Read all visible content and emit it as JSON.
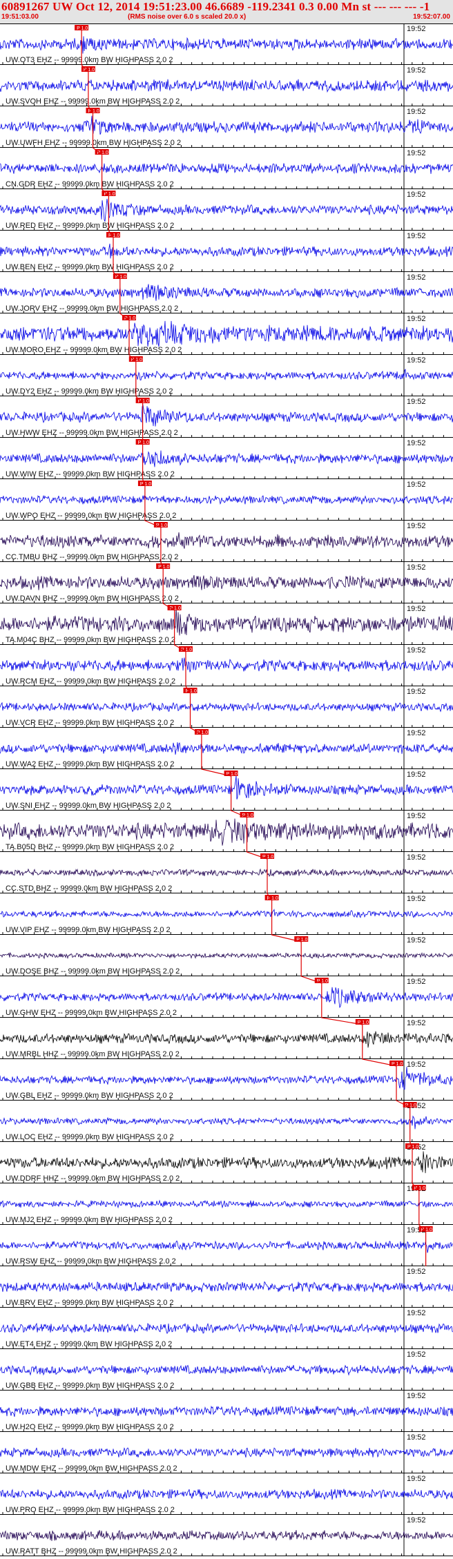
{
  "header": {
    "title": "60891267 UW Oct 12, 2014 19:51:23.00   46.6689 -119.2341  0.3 0.00 Mn st --- --- ---  -1",
    "start_time": "19:51:03.00",
    "note": "(RMS noise over 6.0 s scaled 20.0 x)",
    "end_time": "19:52:07.00"
  },
  "minute_label": "19:52",
  "pick_label": "P 1.0",
  "colors": {
    "blue": "#0000e6",
    "dark": "#1e0050",
    "black": "#000000",
    "pick": "#e00000",
    "grid": "#000000"
  },
  "traces": [
    {
      "label": "UW.OT3 EHZ -- 99999.0km BW  HIGHPASS  2.0  2",
      "color": "blue",
      "pick": 0.18,
      "amp": 0.35,
      "burst": [
        0.18,
        0.26,
        0.85
      ],
      "burst2": [
        0.8,
        0.92,
        0.45
      ]
    },
    {
      "label": "UW.SVOH EHZ -- 99999.0km BW  HIGHPASS  2.0  2",
      "color": "blue",
      "pick": 0.195,
      "amp": 0.35,
      "burst": [
        0.195,
        0.24,
        0.5
      ]
    },
    {
      "label": "UW.UWFH EHZ -- 99999.0km BW  HIGHPASS  2.0  2",
      "color": "blue",
      "pick": 0.205,
      "amp": 0.35,
      "burst": [
        0.2,
        0.26,
        1.0
      ],
      "burst2": [
        0.9,
        1.0,
        0.7
      ]
    },
    {
      "label": "CN.GDR EHZ -- 99999.0km BW  HIGHPASS  2.0  2",
      "color": "blue",
      "pick": 0.225,
      "amp": 0.3,
      "burst": [
        0.22,
        0.28,
        0.5
      ]
    },
    {
      "label": "UW.RED EHZ -- 99999.0km BW  HIGHPASS  2.0  2",
      "color": "blue",
      "pick": 0.24,
      "amp": 0.3,
      "burst": [
        0.22,
        0.32,
        1.0
      ]
    },
    {
      "label": "UW.BEN EHZ -- 99999.0km BW  HIGHPASS  2.0  2",
      "color": "blue",
      "pick": 0.25,
      "amp": 0.3,
      "burst": [
        0.24,
        0.28,
        0.6
      ]
    },
    {
      "label": "UW.JORV EHZ -- 99999.0km BW  HIGHPASS  2.0  2",
      "color": "blue",
      "pick": 0.265,
      "amp": 0.3,
      "burst": [
        0.3,
        0.6,
        0.6
      ]
    },
    {
      "label": "UW.MORO EHZ -- 99999.0km BW  HIGHPASS  2.0  2",
      "color": "blue",
      "pick": 0.285,
      "amp": 0.5,
      "burst": [
        0.28,
        0.85,
        1.0
      ]
    },
    {
      "label": "UW.DY2 EHZ -- 99999.0km BW  HIGHPASS  2.0  2",
      "color": "blue",
      "pick": 0.3,
      "amp": 0.25,
      "burst": [
        0.3,
        0.34,
        0.6
      ],
      "burst2": [
        0.88,
        0.95,
        0.6
      ]
    },
    {
      "label": "UW.HWW EHZ -- 99999.0km BW  HIGHPASS  2.0  2",
      "color": "blue",
      "pick": 0.315,
      "amp": 0.3,
      "burst": [
        0.31,
        0.42,
        1.0
      ]
    },
    {
      "label": "UW.WIW EHZ -- 99999.0km BW  HIGHPASS  2.0  2",
      "color": "blue",
      "pick": 0.315,
      "amp": 0.3,
      "burst": [
        0.31,
        0.42,
        1.0
      ]
    },
    {
      "label": "UW.WPO EHZ -- 99999.0km BW  HIGHPASS  2.0  2",
      "color": "blue",
      "pick": 0.32,
      "amp": 0.25,
      "burst": [
        0.32,
        0.36,
        0.3
      ]
    },
    {
      "label": "CC.TMBU BHZ -- 99999.0km BW  HIGHPASS  2.0  2",
      "color": "dark",
      "pick": 0.355,
      "amp": 0.4,
      "burst": [
        0.36,
        0.85,
        0.6
      ]
    },
    {
      "label": "UW.DAVN BHZ -- 99999.0km BW  HIGHPASS  2.0  2",
      "color": "dark",
      "pick": 0.36,
      "amp": 0.4,
      "burst": [
        0.4,
        0.85,
        0.5
      ],
      "burst2": [
        0.88,
        1.0,
        0.4
      ]
    },
    {
      "label": "TA.M04C BHZ -- 99999.0km BW  HIGHPASS  2.0  2",
      "color": "dark",
      "pick": 0.385,
      "amp": 0.5,
      "burst": [
        0.38,
        0.55,
        1.0
      ]
    },
    {
      "label": "UW.RCM EHZ -- 99999.0km BW  HIGHPASS  2.0  2",
      "color": "blue",
      "pick": 0.41,
      "amp": 0.35,
      "burst": [
        0.4,
        0.45,
        1.0
      ]
    },
    {
      "label": "UW.VCR EHZ -- 99999.0km BW  HIGHPASS  2.0  2",
      "color": "blue",
      "pick": 0.42,
      "amp": 0.25,
      "burst": [
        0.42,
        0.46,
        0.4
      ]
    },
    {
      "label": "UW.WA2 EHZ -- 99999.0km BW  HIGHPASS  2.0  2",
      "color": "blue",
      "pick": 0.445,
      "amp": 0.3,
      "burst": [
        0.38,
        0.48,
        0.7
      ]
    },
    {
      "label": "UW.SNI EHZ -- 99999.0km BW  HIGHPASS  2.0  2",
      "color": "blue",
      "pick": 0.51,
      "amp": 0.3,
      "burst": [
        0.51,
        0.65,
        1.0
      ],
      "burst2": [
        0.2,
        0.25,
        0.6
      ]
    },
    {
      "label": "TA.B05D BHZ -- 99999.0km BW  HIGHPASS  2.0  2",
      "color": "dark",
      "pick": 0.545,
      "amp": 0.5,
      "burst": [
        0.45,
        1.0,
        1.0
      ]
    },
    {
      "label": "CC.STD BHZ -- 99999.0km BW  HIGHPASS  2.0  2",
      "color": "dark",
      "pick": 0.59,
      "amp": 0.2,
      "burst": [
        0.59,
        0.62,
        0.3
      ]
    },
    {
      "label": "UW.VIP EHZ -- 99999.0km BW  HIGHPASS  2.0  2",
      "color": "blue",
      "pick": 0.6,
      "amp": 0.2,
      "burst": [
        0.6,
        0.64,
        0.4
      ]
    },
    {
      "label": "UW.DOSE BHZ -- 99999.0km BW  HIGHPASS  2.0  2",
      "color": "dark",
      "pick": 0.665,
      "amp": 0.15,
      "burst": [
        0.68,
        0.72,
        0.3
      ]
    },
    {
      "label": "UW.GHW EHZ -- 99999.0km BW  HIGHPASS  2.0  2",
      "color": "blue",
      "pick": 0.71,
      "amp": 0.25,
      "burst": [
        0.72,
        0.9,
        0.8
      ]
    },
    {
      "label": "UW.MRBL HHZ -- 99999.0km BW  HIGHPASS  2.0  2",
      "color": "black",
      "pick": 0.8,
      "amp": 0.3,
      "burst": [
        0.8,
        1.0,
        0.7
      ]
    },
    {
      "label": "UW.GBL EHZ -- 99999.0km BW  HIGHPASS  2.0  2",
      "color": "blue",
      "pick": 0.875,
      "amp": 0.25,
      "burst": [
        0.88,
        1.0,
        1.0
      ]
    },
    {
      "label": "UW.LOC EHZ -- 99999.0km BW  HIGHPASS  2.0  2",
      "color": "blue",
      "pick": 0.905,
      "amp": 0.2,
      "burst": [
        0.9,
        0.95,
        0.8
      ]
    },
    {
      "label": "UW.DDRF HHZ -- 99999.0km BW  HIGHPASS  2.0  2",
      "color": "black",
      "pick": 0.91,
      "amp": 0.35,
      "burst": [
        0.92,
        1.0,
        1.0
      ]
    },
    {
      "label": "UW.MJ2 EHZ -- 99999.0km BW  HIGHPASS  2.0  2",
      "color": "blue",
      "pick": 0.925,
      "amp": 0.2,
      "burst": [
        0.93,
        0.96,
        0.4
      ]
    },
    {
      "label": "UW.RSW EHZ -- 99999.0km BW  HIGHPASS  2.0  2",
      "color": "blue",
      "pick": 0.94,
      "amp": 0.25,
      "burst": [
        0.94,
        1.0,
        0.8
      ]
    },
    {
      "label": "UW.BRV EHZ -- 99999.0km BW  HIGHPASS  2.0  2",
      "color": "blue",
      "amp": 0.3
    },
    {
      "label": "UW.ET4 EHZ -- 99999.0km BW  HIGHPASS  2.0  2",
      "color": "blue",
      "amp": 0.28
    },
    {
      "label": "UW.GBB EHZ -- 99999.0km BW  HIGHPASS  2.0  2",
      "color": "blue",
      "amp": 0.28
    },
    {
      "label": "UW.H2O EHZ -- 99999.0km BW  HIGHPASS  2.0  2",
      "color": "blue",
      "amp": 0.3
    },
    {
      "label": "UW.MDW EHZ -- 99999.0km BW  HIGHPASS  2.0  2",
      "color": "blue",
      "amp": 0.28
    },
    {
      "label": "UW.PRO EHZ -- 99999.0km BW  HIGHPASS  2.0  2",
      "color": "blue",
      "amp": 0.3
    },
    {
      "label": "UW.RATT BHZ -- 99999.0km BW  HIGHPASS  2.0  2",
      "color": "dark",
      "amp": 0.3
    }
  ]
}
